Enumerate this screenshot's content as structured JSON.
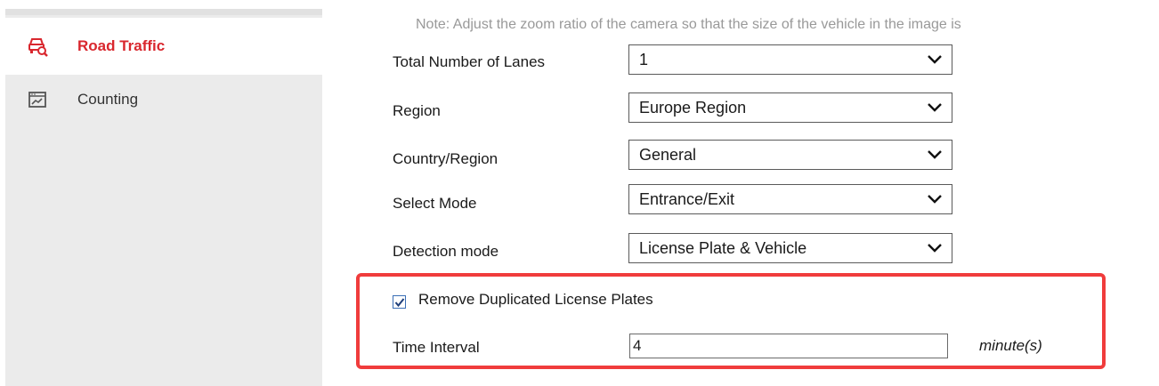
{
  "sidebar": {
    "items": [
      {
        "label": "Road Traffic",
        "icon": "road-traffic-icon",
        "active": true
      },
      {
        "label": "Counting",
        "icon": "counting-icon",
        "active": false
      }
    ]
  },
  "note": "Note: Adjust the zoom ratio of the camera so that the size of the vehicle in the image is",
  "form": {
    "total_lanes": {
      "label": "Total Number of Lanes",
      "value": "1"
    },
    "region": {
      "label": "Region",
      "value": "Europe Region"
    },
    "country_region": {
      "label": "Country/Region",
      "value": "General"
    },
    "select_mode": {
      "label": "Select Mode",
      "value": "Entrance/Exit"
    },
    "detection_mode": {
      "label": "Detection mode",
      "value": "License Plate & Vehicle"
    },
    "remove_duplicates": {
      "label": "Remove Duplicated License Plates",
      "checked": true
    },
    "time_interval": {
      "label": "Time Interval",
      "value": "4",
      "unit": "minute(s)"
    }
  },
  "colors": {
    "accent": "#d9272e",
    "highlight_border": "#f03c3c",
    "checkbox": "#3b6fb6"
  }
}
